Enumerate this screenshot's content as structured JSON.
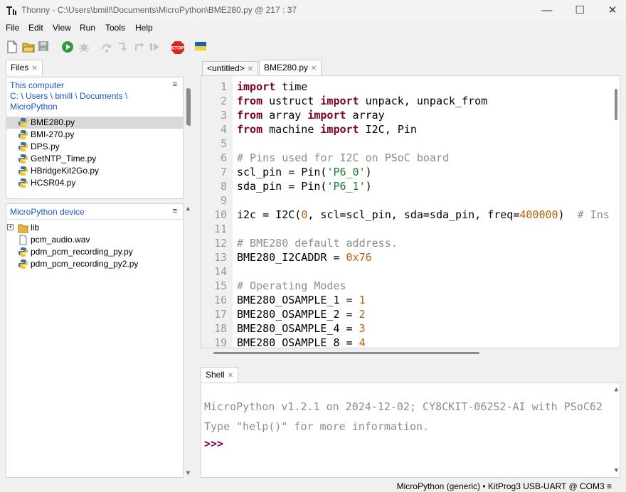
{
  "window": {
    "title": "Thonny  -  C:\\Users\\bmill\\Documents\\MicroPython\\BME280.py  @  217 : 37",
    "minimize": "—",
    "maximize": "☐",
    "close": "✕"
  },
  "menu": [
    "File",
    "Edit",
    "View",
    "Run",
    "Tools",
    "Help"
  ],
  "toolbar": {
    "icons": [
      "new-file-icon",
      "open-folder-icon",
      "save-icon",
      "run-icon",
      "debug-icon",
      "step-over-icon",
      "step-into-icon",
      "step-out-icon",
      "resume-icon",
      "stop-icon",
      "ukraine-flag-icon"
    ],
    "stop_label": "STOP"
  },
  "files": {
    "tab_label": "Files",
    "computer": {
      "header": "This computer",
      "path": "C: \\ Users \\ bmill \\ Documents \\",
      "path2": "MicroPython",
      "items": [
        "BME280.py",
        "BMI-270.py",
        "DPS.py",
        "GetNTP_Time.py",
        "HBridgeKit2Go.py",
        "HCSR04.py"
      ],
      "selected": "BME280.py"
    },
    "device": {
      "header": "MicroPython device",
      "items": [
        {
          "name": "lib",
          "type": "folder"
        },
        {
          "name": "pcm_audio.wav",
          "type": "file"
        },
        {
          "name": "pdm_pcm_recording_py.py",
          "type": "python"
        },
        {
          "name": "pdm_pcm_recording_py2.py",
          "type": "python"
        }
      ]
    }
  },
  "editor": {
    "tabs": [
      "<untitled>",
      "BME280.py"
    ],
    "active_tab": "BME280.py",
    "line_numbers": [
      "1",
      "2",
      "3",
      "4",
      "5",
      "6",
      "7",
      "8",
      "9",
      "10",
      "11",
      "12",
      "13",
      "14",
      "15",
      "16",
      "17",
      "18",
      "19"
    ],
    "lines": [
      "import time",
      "from ustruct import unpack, unpack_from",
      "from array import array",
      "from machine import I2C, Pin",
      "",
      "# Pins used for I2C on PSoC board",
      "scl_pin = Pin('P6_0')",
      "sda_pin = Pin('P6_1')",
      "",
      "i2c = I2C(0, scl=scl_pin, sda=sda_pin, freq=400000)  # Ins",
      "",
      "# BME280 default address.",
      "BME280_I2CADDR = 0x76",
      "",
      "# Operating Modes",
      "BME280_OSAMPLE_1 = 1",
      "BME280_OSAMPLE_2 = 2",
      "BME280_OSAMPLE_4 = 3",
      "BME280_OSAMPLE_8 = 4"
    ]
  },
  "shell": {
    "tab_label": "Shell",
    "banner": "MicroPython v1.2.1 on 2024-12-02; CY8CKIT-062S2-AI with PSoC62",
    "help": "Type \"help()\" for more information.",
    "prompt": ">>>"
  },
  "status": {
    "text": "MicroPython (generic)  •  KitProg3 USB-UART @ COM3  ≡"
  },
  "colors": {
    "keyword": "#7a0026",
    "string": "#167c2a",
    "number": "#b8600c",
    "comment": "#8d8d8d",
    "link": "#1c56c7",
    "prompt": "#7f0055"
  }
}
